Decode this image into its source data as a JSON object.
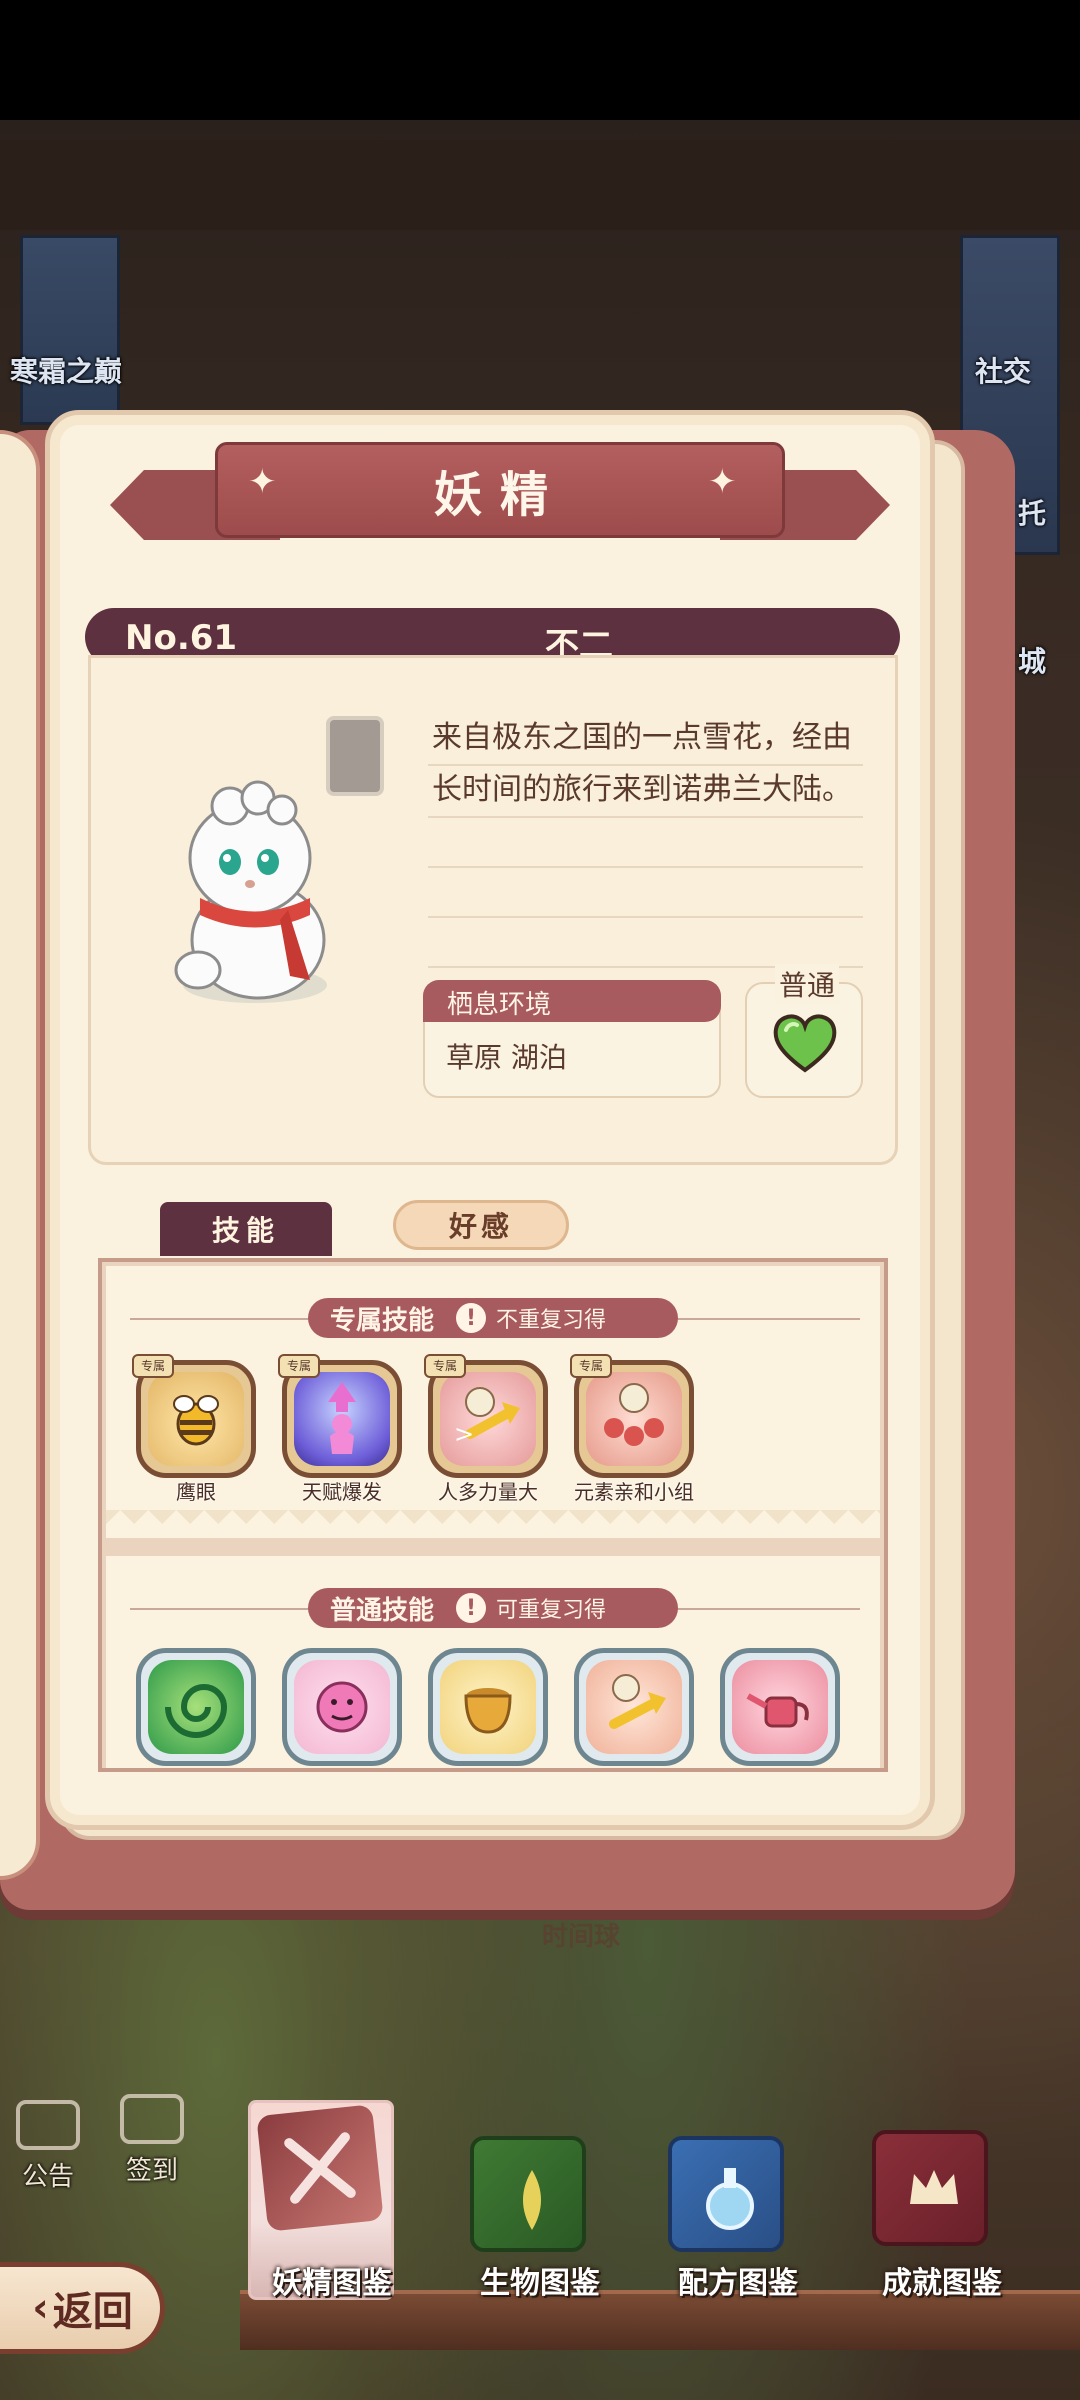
{
  "background": {
    "left_banner": "寒霜之巅",
    "right_banner": "社交",
    "right_banner_partial": [
      "托",
      "城"
    ],
    "faded_label": "时间球"
  },
  "book": {
    "title": "妖精",
    "number": "No.61",
    "name": "不二",
    "description": "来自极东之国的一点雪花，经由长时间的旅行来到诺弗兰大陆。",
    "habitat": {
      "label": "栖息环境",
      "value": "草原 湖泊"
    },
    "rarity": {
      "label": "普通",
      "icon": "green-heart-icon",
      "color": "#6cc24a"
    },
    "tabs": [
      {
        "label": "技能",
        "active": true
      },
      {
        "label": "好感",
        "active": false
      }
    ],
    "exclusive_skills": {
      "title": "专属技能",
      "note": "不重复习得",
      "badge": "专属",
      "items": [
        {
          "label": "鹰眼",
          "icon": "bee-icon"
        },
        {
          "label": "天赋爆发",
          "icon": "burst-figure-icon"
        },
        {
          "label": "人多力量大",
          "icon": "bags-arrow-icon"
        },
        {
          "label": "元素亲和小组",
          "icon": "element-group-icon"
        }
      ]
    },
    "normal_skills": {
      "title": "普通技能",
      "note": "可重复习得",
      "items": [
        {
          "label": "",
          "icon": "green-swirl-icon"
        },
        {
          "label": "",
          "icon": "pink-face-icon"
        },
        {
          "label": "",
          "icon": "golden-pot-icon"
        },
        {
          "label": "",
          "icon": "bags-arrow-icon"
        },
        {
          "label": "",
          "icon": "watering-can-icon"
        }
      ]
    }
  },
  "side_menu": [
    {
      "label": "公告",
      "icon": "notice-board-icon"
    },
    {
      "label": "签到",
      "icon": "calendar-icon"
    }
  ],
  "dock": {
    "back_label": "返回",
    "items": [
      {
        "label": "妖精图鉴",
        "icon": "fairy-codex-icon",
        "active": true
      },
      {
        "label": "生物图鉴",
        "icon": "creature-codex-icon",
        "active": false
      },
      {
        "label": "配方图鉴",
        "icon": "recipe-codex-icon",
        "active": false
      },
      {
        "label": "成就图鉴",
        "icon": "achievement-codex-icon",
        "active": false
      }
    ]
  }
}
